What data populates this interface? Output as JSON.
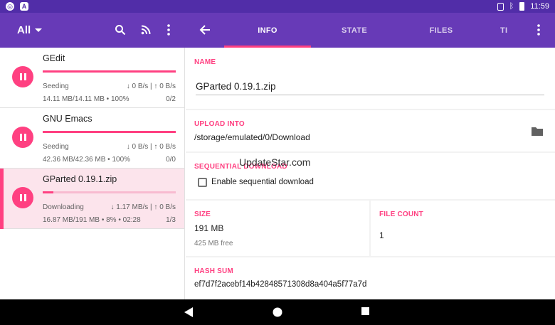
{
  "status_bar": {
    "icons": [
      "chrome-icon",
      "a-icon",
      "vibrate-icon",
      "bluetooth-icon",
      "battery-icon"
    ],
    "time": "11:59"
  },
  "left_bar": {
    "filter_label": "All",
    "icons": [
      "search-icon",
      "rss-icon",
      "more-vert-icon"
    ]
  },
  "tabs": [
    {
      "label": "INFO",
      "active": true
    },
    {
      "label": "STATE",
      "active": false
    },
    {
      "label": "FILES",
      "active": false
    },
    {
      "label": "TI",
      "active": false
    }
  ],
  "torrents": [
    {
      "name": "GEdit",
      "state": "Seeding",
      "speed": "↓ 0 B/s | ↑ 0 B/s",
      "size": "14.11 MB/14.11 MB • 100%",
      "peers": "0/2",
      "progress": 1.0
    },
    {
      "name": "GNU Emacs",
      "state": "Seeding",
      "speed": "↓ 0 B/s | ↑ 0 B/s",
      "size": "42.36 MB/42.36 MB • 100%",
      "peers": "0/0",
      "progress": 1.0
    },
    {
      "name": "GParted 0.19.1.zip",
      "state": "Downloading",
      "speed": "↓ 1.17 MB/s | ↑ 0 B/s",
      "size": "16.87 MB/191 MB • 8% • 02:28",
      "peers": "1/3",
      "progress": 0.08
    }
  ],
  "detail": {
    "name_label": "NAME",
    "name_value": "GParted 0.19.1.zip",
    "upload_label": "UPLOAD INTO",
    "upload_path": "/storage/emulated/0/Download",
    "sequential_label": "SEQUENTIAL DOWNLOAD",
    "sequential_checkbox": "Enable sequential download",
    "size_label": "SIZE",
    "size_value": "191 MB",
    "free_space": "425 MB free",
    "file_count_label": "FILE COUNT",
    "file_count_value": "1",
    "hash_label": "HASH SUM",
    "hash_value": "ef7d7f2acebf14b42848571308d8a404a5f77a7d"
  },
  "watermark": "UpdateStar.com",
  "colors": {
    "primary": "#673ab7",
    "primary_dark": "#512da8",
    "accent": "#ff4081"
  }
}
